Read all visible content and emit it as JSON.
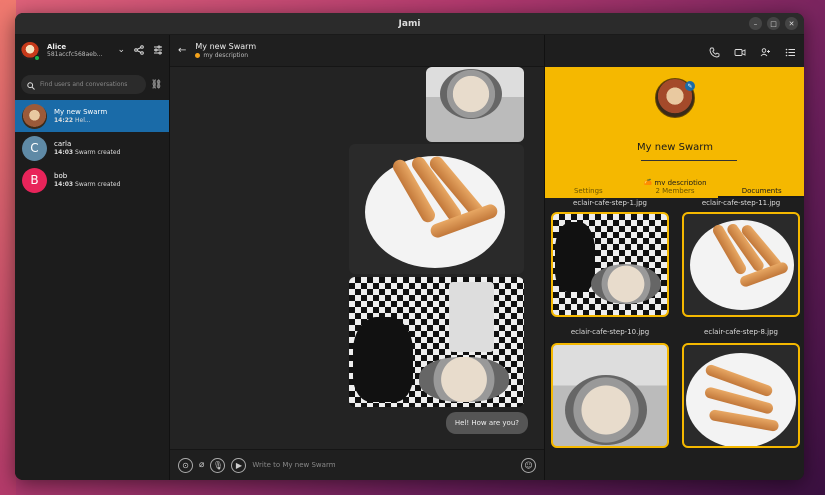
{
  "window": {
    "title": "Jami"
  },
  "account": {
    "name": "Alice",
    "id": "581accfc568aeb..."
  },
  "search": {
    "placeholder": "Find users and conversations"
  },
  "conversations": [
    {
      "name": "My new Swarm",
      "time": "14:22",
      "preview": "Hel...",
      "active": true,
      "avatar_color": "#8a5a3a",
      "initial": ""
    },
    {
      "name": "carla",
      "time": "14:03",
      "preview": "Swarm created",
      "active": false,
      "avatar_color": "#5f8aa6",
      "initial": "C"
    },
    {
      "name": "bob",
      "time": "14:03",
      "preview": "Swarm created",
      "active": false,
      "avatar_color": "#e8245a",
      "initial": "B"
    }
  ],
  "chat": {
    "title": "My new Swarm",
    "description": "my description",
    "last_message": "Hel! How are you?",
    "composer_placeholder": "Write to My new Swarm"
  },
  "details": {
    "name": "My new Swarm",
    "description": "my description",
    "accent_color": "#f5b800",
    "tabs": [
      "Settings",
      "2 Members",
      "Documents"
    ],
    "active_tab": "Documents",
    "documents": [
      {
        "name": "eclair-cafe-step-1.jpg"
      },
      {
        "name": "eclair-cafe-step-11.jpg"
      },
      {
        "name": "eclair-cafe-step-10.jpg"
      },
      {
        "name": "eclair-cafe-step-8.jpg"
      }
    ]
  },
  "icons": {
    "call": "phone-icon",
    "video": "video-icon",
    "add_member": "add-member-icon",
    "details": "details-icon",
    "share": "share-icon",
    "settings": "settings-icon"
  }
}
